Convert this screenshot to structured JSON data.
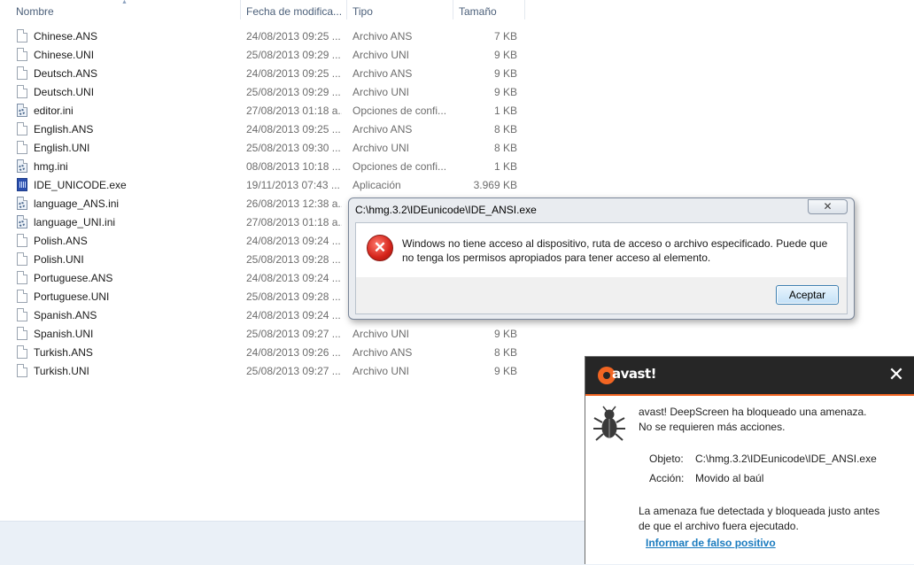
{
  "explorer": {
    "columns": {
      "name": "Nombre",
      "date": "Fecha de modifica...",
      "type": "Tipo",
      "size": "Tamaño"
    },
    "files": [
      {
        "name": "Chinese.ANS",
        "date": "24/08/2013 09:25 ...",
        "type": "Archivo ANS",
        "size": "7 KB",
        "icon": "document-icon"
      },
      {
        "name": "Chinese.UNI",
        "date": "25/08/2013 09:29 ...",
        "type": "Archivo UNI",
        "size": "9 KB",
        "icon": "document-icon"
      },
      {
        "name": "Deutsch.ANS",
        "date": "24/08/2013 09:25 ...",
        "type": "Archivo ANS",
        "size": "9 KB",
        "icon": "document-icon"
      },
      {
        "name": "Deutsch.UNI",
        "date": "25/08/2013 09:29 ...",
        "type": "Archivo UNI",
        "size": "9 KB",
        "icon": "document-icon"
      },
      {
        "name": "editor.ini",
        "date": "27/08/2013 01:18 a...",
        "type": "Opciones de confi...",
        "size": "1 KB",
        "icon": "settings-file-icon"
      },
      {
        "name": "English.ANS",
        "date": "24/08/2013 09:25 ...",
        "type": "Archivo ANS",
        "size": "8 KB",
        "icon": "document-icon"
      },
      {
        "name": "English.UNI",
        "date": "25/08/2013 09:30 ...",
        "type": "Archivo UNI",
        "size": "8 KB",
        "icon": "document-icon"
      },
      {
        "name": "hmg.ini",
        "date": "08/08/2013 10:18 ...",
        "type": "Opciones de confi...",
        "size": "1 KB",
        "icon": "settings-file-icon"
      },
      {
        "name": "IDE_UNICODE.exe",
        "date": "19/11/2013 07:43 ...",
        "type": "Aplicación",
        "size": "3.969 KB",
        "icon": "application-icon"
      },
      {
        "name": "language_ANS.ini",
        "date": "26/08/2013 12:38 a...",
        "type": "",
        "size": "",
        "icon": "settings-file-icon"
      },
      {
        "name": "language_UNI.ini",
        "date": "27/08/2013 01:18 a...",
        "type": "",
        "size": "",
        "icon": "settings-file-icon"
      },
      {
        "name": "Polish.ANS",
        "date": "24/08/2013 09:24 ...",
        "type": "",
        "size": "",
        "icon": "document-icon"
      },
      {
        "name": "Polish.UNI",
        "date": "25/08/2013 09:28 ...",
        "type": "",
        "size": "",
        "icon": "document-icon"
      },
      {
        "name": "Portuguese.ANS",
        "date": "24/08/2013 09:24 ...",
        "type": "",
        "size": "",
        "icon": "document-icon"
      },
      {
        "name": "Portuguese.UNI",
        "date": "25/08/2013 09:28 ...",
        "type": "",
        "size": "",
        "icon": "document-icon"
      },
      {
        "name": "Spanish.ANS",
        "date": "24/08/2013 09:24 ...",
        "type": "",
        "size": "",
        "icon": "document-icon"
      },
      {
        "name": "Spanish.UNI",
        "date": "25/08/2013 09:27 ...",
        "type": "Archivo UNI",
        "size": "9 KB",
        "icon": "document-icon"
      },
      {
        "name": "Turkish.ANS",
        "date": "24/08/2013 09:26 ...",
        "type": "Archivo ANS",
        "size": "8 KB",
        "icon": "document-icon"
      },
      {
        "name": "Turkish.UNI",
        "date": "25/08/2013 09:27 ...",
        "type": "Archivo UNI",
        "size": "9 KB",
        "icon": "document-icon"
      }
    ]
  },
  "error_dialog": {
    "title": "C:\\hmg.3.2\\IDEunicode\\IDE_ANSI.exe",
    "close_label": "✕",
    "icon": "error-icon",
    "message": "Windows no tiene acceso al dispositivo, ruta de acceso o archivo especificado. Puede que no tenga los permisos apropiados para tener acceso al elemento.",
    "accept_label": "Aceptar"
  },
  "avast": {
    "brand": "avast!",
    "brand_color": "#f26522",
    "close_label": "✕",
    "headline": "avast! DeepScreen ha bloqueado una amenaza.",
    "subline": "No se requieren más acciones.",
    "object_label": "Objeto:",
    "object_value": "C:\\hmg.3.2\\IDEunicode\\IDE_ANSI.exe",
    "action_label": "Acción:",
    "action_value": "Movido al baúl",
    "detail_line1": "La amenaza fue detectada y bloqueada justo antes",
    "detail_line2": "de que el archivo fuera ejecutado.",
    "link": "Informar de falso positivo"
  }
}
